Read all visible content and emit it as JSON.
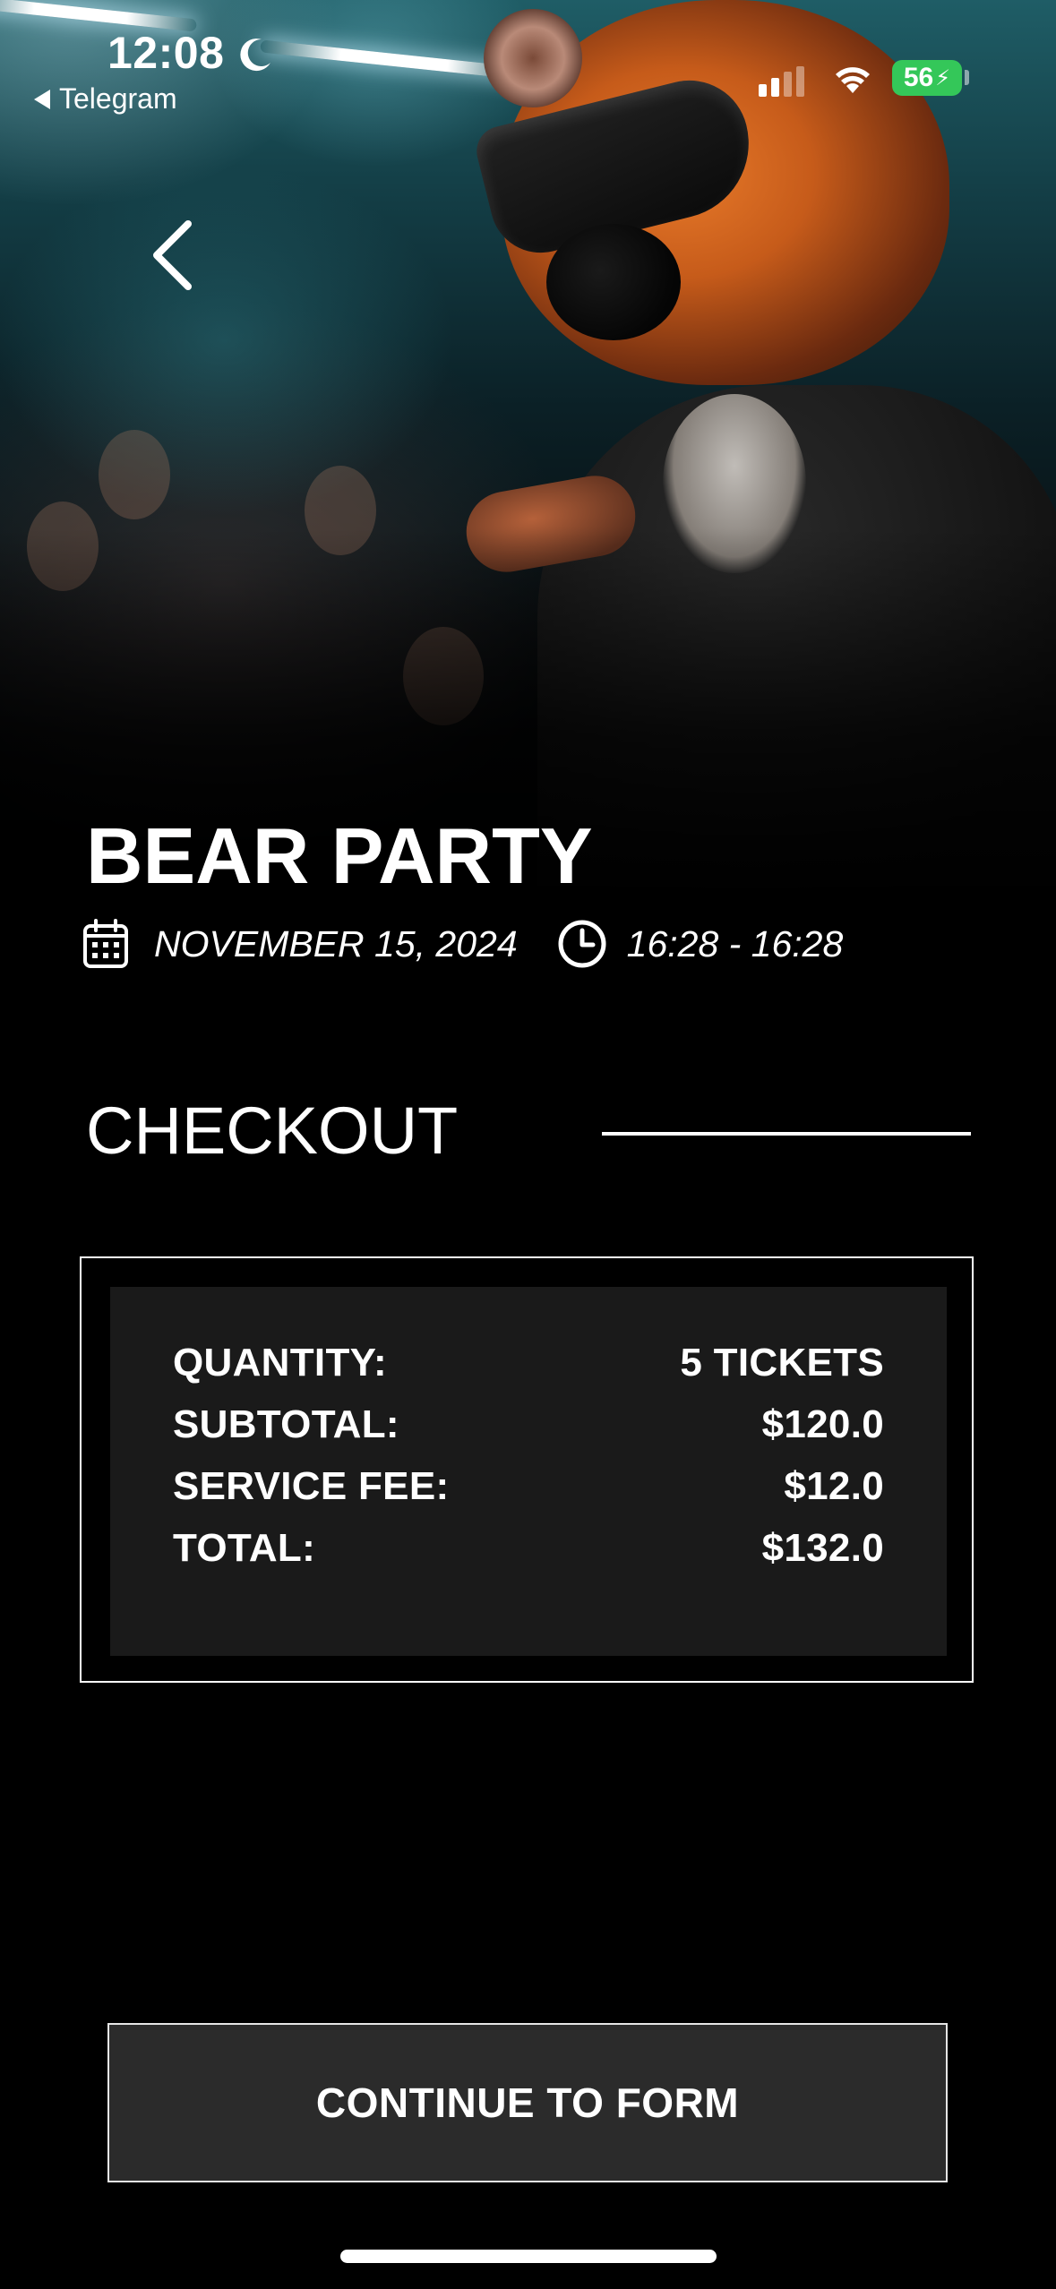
{
  "status_bar": {
    "time": "12:08",
    "back_app": "Telegram",
    "battery": "56"
  },
  "event": {
    "title": "BEAR PARTY",
    "date": "NOVEMBER 15, 2024",
    "time_range": "16:28 - 16:28"
  },
  "checkout": {
    "title": "CHECKOUT",
    "rows": [
      {
        "label": "QUANTITY:",
        "value": "5 TICKETS"
      },
      {
        "label": "SUBTOTAL:",
        "value": "$120.0"
      },
      {
        "label": "SERVICE FEE:",
        "value": "$12.0"
      },
      {
        "label": "TOTAL:",
        "value": "$132.0"
      }
    ]
  },
  "actions": {
    "continue_label": "CONTINUE TO FORM"
  },
  "colors": {
    "background": "#000000",
    "panel": "#1a1a1a",
    "button": "#2b2b2b",
    "battery": "#34c759"
  },
  "icons": [
    "moon-icon",
    "signal-icon",
    "wifi-icon",
    "back-chevron-icon",
    "calendar-icon",
    "clock-icon"
  ]
}
